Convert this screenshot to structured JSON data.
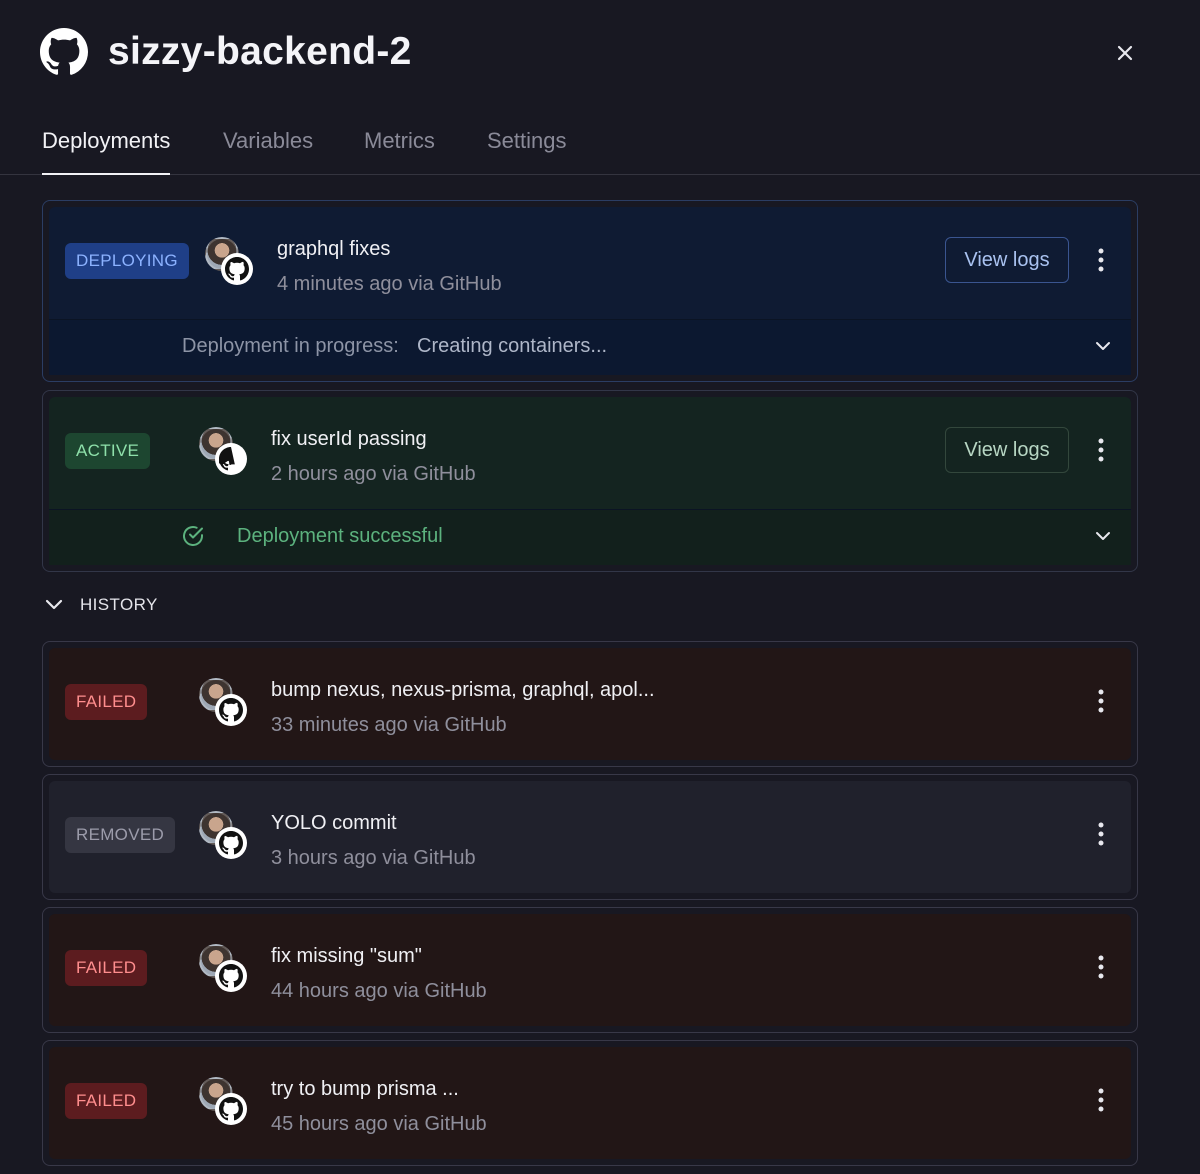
{
  "header": {
    "title": "sizzy-backend-2",
    "logo_icon": "github-icon",
    "close_icon": "close-icon"
  },
  "tabs": [
    {
      "label": "Deployments",
      "active": true
    },
    {
      "label": "Variables",
      "active": false
    },
    {
      "label": "Metrics",
      "active": false
    },
    {
      "label": "Settings",
      "active": false
    }
  ],
  "current": [
    {
      "status": "DEPLOYING",
      "message": "graphql fixes",
      "meta": "4 minutes ago via GitHub",
      "view_logs": "View logs",
      "progress_label": "Deployment in progress:",
      "progress_value": "Creating containers..."
    },
    {
      "status": "ACTIVE",
      "message": "fix userId passing",
      "meta": "2 hours ago via GitHub",
      "view_logs": "View logs",
      "success_label": "Deployment successful"
    }
  ],
  "history": {
    "label": "HISTORY",
    "items": [
      {
        "status": "FAILED",
        "message": "bump nexus, nexus-prisma, graphql, apol...",
        "meta": "33 minutes ago via GitHub"
      },
      {
        "status": "REMOVED",
        "message": "YOLO commit",
        "meta": "3 hours ago via GitHub"
      },
      {
        "status": "FAILED",
        "message": "fix missing \"sum\"",
        "meta": "44 hours ago via GitHub"
      },
      {
        "status": "FAILED",
        "message": "try to bump prisma ...",
        "meta": "45 hours ago via GitHub"
      }
    ]
  },
  "colors": {
    "background": "#181822",
    "deploying": "#1f3f87",
    "active": "#1d4630",
    "failed": "#5c1c1f",
    "removed": "#353642",
    "success_text": "#5cb27e"
  }
}
